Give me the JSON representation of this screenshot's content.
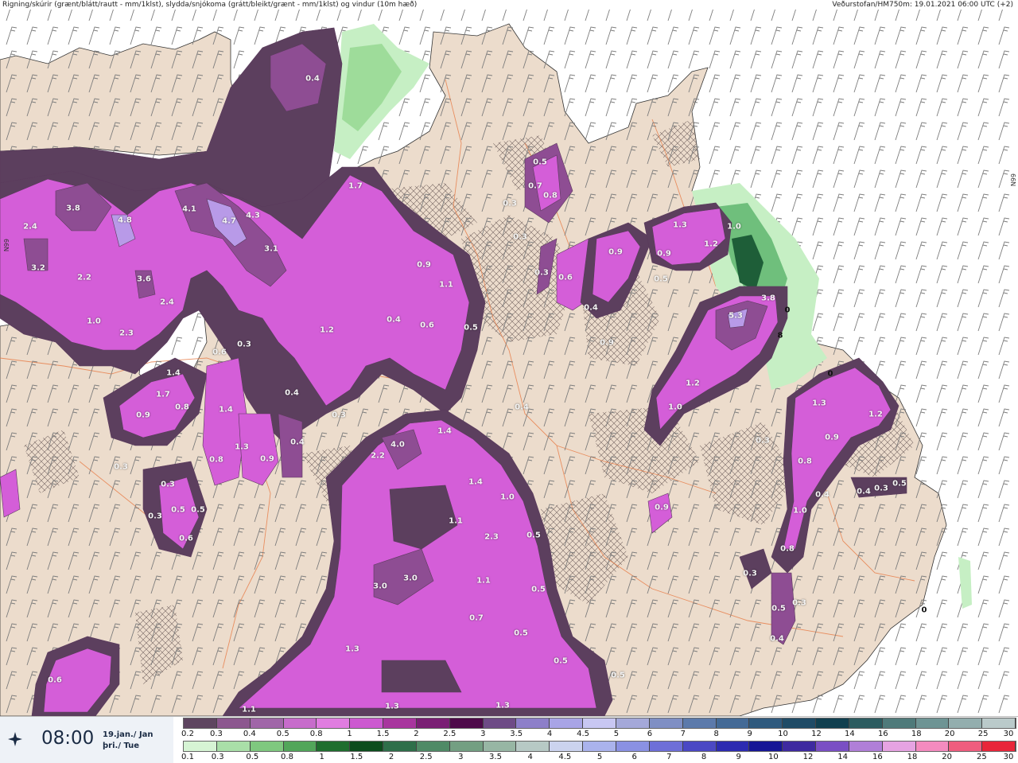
{
  "header": {
    "left": "Rigning/skúrir (grænt/blátt/rautt - mm/1klst), slydda/snjókoma (grátt/bleikt/grænt - mm/1klst) og vindur (10m hæð)",
    "right": "Veðurstofan/HM750m: 19.01.2021 06:00 UTC (+2)"
  },
  "latitude_labels": {
    "right": "66N",
    "left": "66N"
  },
  "map": {
    "colors": {
      "sea": "#ffffff",
      "land": "#ecdccc",
      "road": "#e8804c",
      "hatch": "#6a5a58",
      "dark_purple": "#5c3f5e",
      "mid_purple": "#8e4d93",
      "magenta": "#d45ed8",
      "light_magenta": "#e88be6",
      "lilac": "#b89ae8",
      "dark_green": "#1e5e38",
      "mid_green": "#6fbf7c",
      "light_green": "#c6efc4"
    },
    "values": [
      {
        "t": "0.4"
      },
      {
        "t": "1.7"
      },
      {
        "t": "3.8"
      },
      {
        "t": "4.8"
      },
      {
        "t": "4.1"
      },
      {
        "t": "4.7"
      },
      {
        "t": "4.3"
      },
      {
        "t": "3.1"
      },
      {
        "t": "2.4"
      },
      {
        "t": "3.2"
      },
      {
        "t": "2.2"
      },
      {
        "t": "3.6"
      },
      {
        "t": "2.4"
      },
      {
        "t": "1.0"
      },
      {
        "t": "2.3"
      },
      {
        "t": "1.4"
      },
      {
        "t": "1.7"
      },
      {
        "t": "0.8"
      },
      {
        "t": "0.9"
      },
      {
        "t": "0.3"
      },
      {
        "t": "1.4"
      },
      {
        "t": "1.3"
      },
      {
        "t": "0.8"
      },
      {
        "t": "0.9"
      },
      {
        "t": "0.4"
      },
      {
        "t": "0.3"
      },
      {
        "t": "0.5"
      },
      {
        "t": "0.5"
      },
      {
        "t": "0.3"
      },
      {
        "t": "0.6"
      },
      {
        "t": "0.3"
      },
      {
        "t": "0.6"
      },
      {
        "t": "1.2"
      },
      {
        "t": "0.4"
      },
      {
        "t": "0.6"
      },
      {
        "t": "0.9"
      },
      {
        "t": "1.1"
      },
      {
        "t": "0.5"
      },
      {
        "t": "0.4"
      },
      {
        "t": "0.3"
      },
      {
        "t": "0.5"
      },
      {
        "t": "0.7"
      },
      {
        "t": "0.8"
      },
      {
        "t": "0.3"
      },
      {
        "t": "0.3"
      },
      {
        "t": "0.3"
      },
      {
        "t": "0.6"
      },
      {
        "t": "0.9"
      },
      {
        "t": "0.4"
      },
      {
        "t": "0.9"
      },
      {
        "t": "0.9"
      },
      {
        "t": "0.5"
      },
      {
        "t": "1.3"
      },
      {
        "t": "1.2"
      },
      {
        "t": "1.0"
      },
      {
        "t": "5.3"
      },
      {
        "t": "3.8"
      },
      {
        "t": "1.2"
      },
      {
        "t": "1.0"
      },
      {
        "t": "0.3"
      },
      {
        "t": "1.3"
      },
      {
        "t": "1.2"
      },
      {
        "t": "0.9"
      },
      {
        "t": "0.8"
      },
      {
        "t": "0.4"
      },
      {
        "t": "0.4"
      },
      {
        "t": "0.3"
      },
      {
        "t": "0.5"
      },
      {
        "t": "1.0"
      },
      {
        "t": "0.8"
      },
      {
        "t": "0.3"
      },
      {
        "t": "0.5"
      },
      {
        "t": "0.3"
      },
      {
        "t": "0.4"
      },
      {
        "t": "0.9"
      },
      {
        "t": "4.0"
      },
      {
        "t": "2.2"
      },
      {
        "t": "1.4"
      },
      {
        "t": "1.4"
      },
      {
        "t": "1.0"
      },
      {
        "t": "1.1"
      },
      {
        "t": "2.3"
      },
      {
        "t": "0.5"
      },
      {
        "t": "3.0"
      },
      {
        "t": "3.0"
      },
      {
        "t": "1.1"
      },
      {
        "t": "0.5"
      },
      {
        "t": "0.7"
      },
      {
        "t": "0.5"
      },
      {
        "t": "1.3"
      },
      {
        "t": "0.5"
      },
      {
        "t": "0.5"
      },
      {
        "t": "1.3"
      },
      {
        "t": "1.3"
      },
      {
        "t": "1.1"
      },
      {
        "t": "0.6"
      },
      {
        "t": "0.4"
      }
    ],
    "contour_labels": [
      "0",
      "8",
      "0",
      "0"
    ]
  },
  "footer": {
    "time": "08:00",
    "date_line1": "19.jan./ Jan",
    "date_line2": "þri./ Tue",
    "rain_scale": {
      "labels": [
        "0.2",
        "0.3",
        "0.4",
        "0.5",
        "0.8",
        "1",
        "1.5",
        "2",
        "2.5",
        "3",
        "3.5",
        "4",
        "4.5",
        "5",
        "6",
        "7",
        "8",
        "9",
        "10",
        "12",
        "14",
        "16",
        "18",
        "20",
        "25",
        "30"
      ],
      "colors": [
        "#5e4560",
        "#8c578f",
        "#a066a8",
        "#c76ccb",
        "#e07de0",
        "#cc59d0",
        "#a8359e",
        "#7a1f74",
        "#4e0a4a",
        "#6e4b86",
        "#8d7fc9",
        "#a8a4e6",
        "#c8c7f2",
        "#a4a8d9",
        "#7f8fc4",
        "#5c7aab",
        "#446a96",
        "#2f5a7e",
        "#1f4b66",
        "#114050",
        "#2c5c60",
        "#4f7a7a",
        "#6e9494",
        "#93aeae",
        "#bacaca"
      ]
    },
    "snow_scale": {
      "labels": [
        "0.1",
        "0.3",
        "0.5",
        "0.8",
        "1",
        "1.5",
        "2",
        "2.5",
        "3",
        "3.5",
        "4",
        "4.5",
        "5",
        "6",
        "7",
        "8",
        "9",
        "10",
        "12",
        "14",
        "16",
        "18",
        "20",
        "25",
        "30"
      ],
      "colors": [
        "#d6f4d4",
        "#a9dfa8",
        "#7fc87f",
        "#52a65a",
        "#1f6e2e",
        "#0c4d1d",
        "#2e6f4a",
        "#4f8a66",
        "#739f82",
        "#97b6a4",
        "#b7c9c5",
        "#cbd3ee",
        "#aab3ec",
        "#8a91e3",
        "#6e6fd8",
        "#4b48c4",
        "#2c2bb1",
        "#161696",
        "#3e2aa0",
        "#7a4fc4",
        "#b07fd8",
        "#e6a3e2",
        "#f48bbf",
        "#ef5d7e",
        "#e8263a"
      ]
    }
  }
}
